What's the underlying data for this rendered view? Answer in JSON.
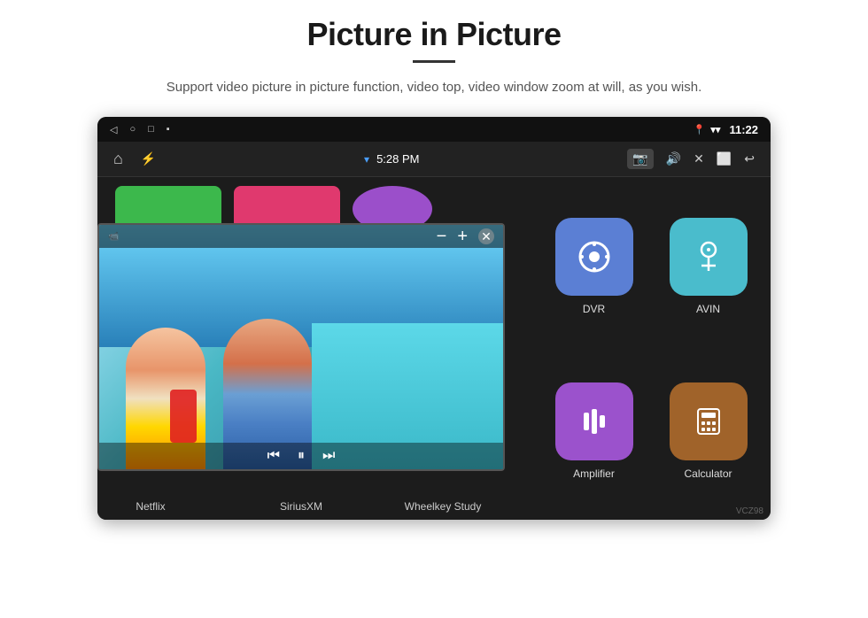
{
  "header": {
    "title": "Picture in Picture",
    "subtitle": "Support video picture in picture function, video top, video window zoom at will, as you wish."
  },
  "statusBar": {
    "time": "11:22",
    "navIcons": [
      "◁",
      "○",
      "□",
      "⬛"
    ]
  },
  "navBar": {
    "homeIcon": "⌂",
    "usbIcon": "⚡",
    "time": "5:28 PM",
    "icons": [
      "📷",
      "🔊",
      "✕",
      "⬜",
      "↩"
    ]
  },
  "appButtons": [
    {
      "label": "Netflix",
      "colorClass": "app-btn-green"
    },
    {
      "label": "SiriusXM",
      "colorClass": "app-btn-pink"
    },
    {
      "label": "",
      "colorClass": "app-btn-purple"
    }
  ],
  "appLabels": [
    {
      "name": "Netflix"
    },
    {
      "name": "SiriusXM"
    },
    {
      "name": "Wheelkey Study"
    }
  ],
  "rightApps": [
    {
      "name": "DVR",
      "icon": "📡",
      "colorClass": "app-icon-dvr"
    },
    {
      "name": "AVIN",
      "icon": "🎛",
      "colorClass": "app-icon-avin"
    },
    {
      "name": "Amplifier",
      "icon": "🎚",
      "colorClass": "app-icon-amp"
    },
    {
      "name": "Calculator",
      "icon": "🖩",
      "colorClass": "app-icon-calc"
    }
  ],
  "watermark": "VCZ98"
}
